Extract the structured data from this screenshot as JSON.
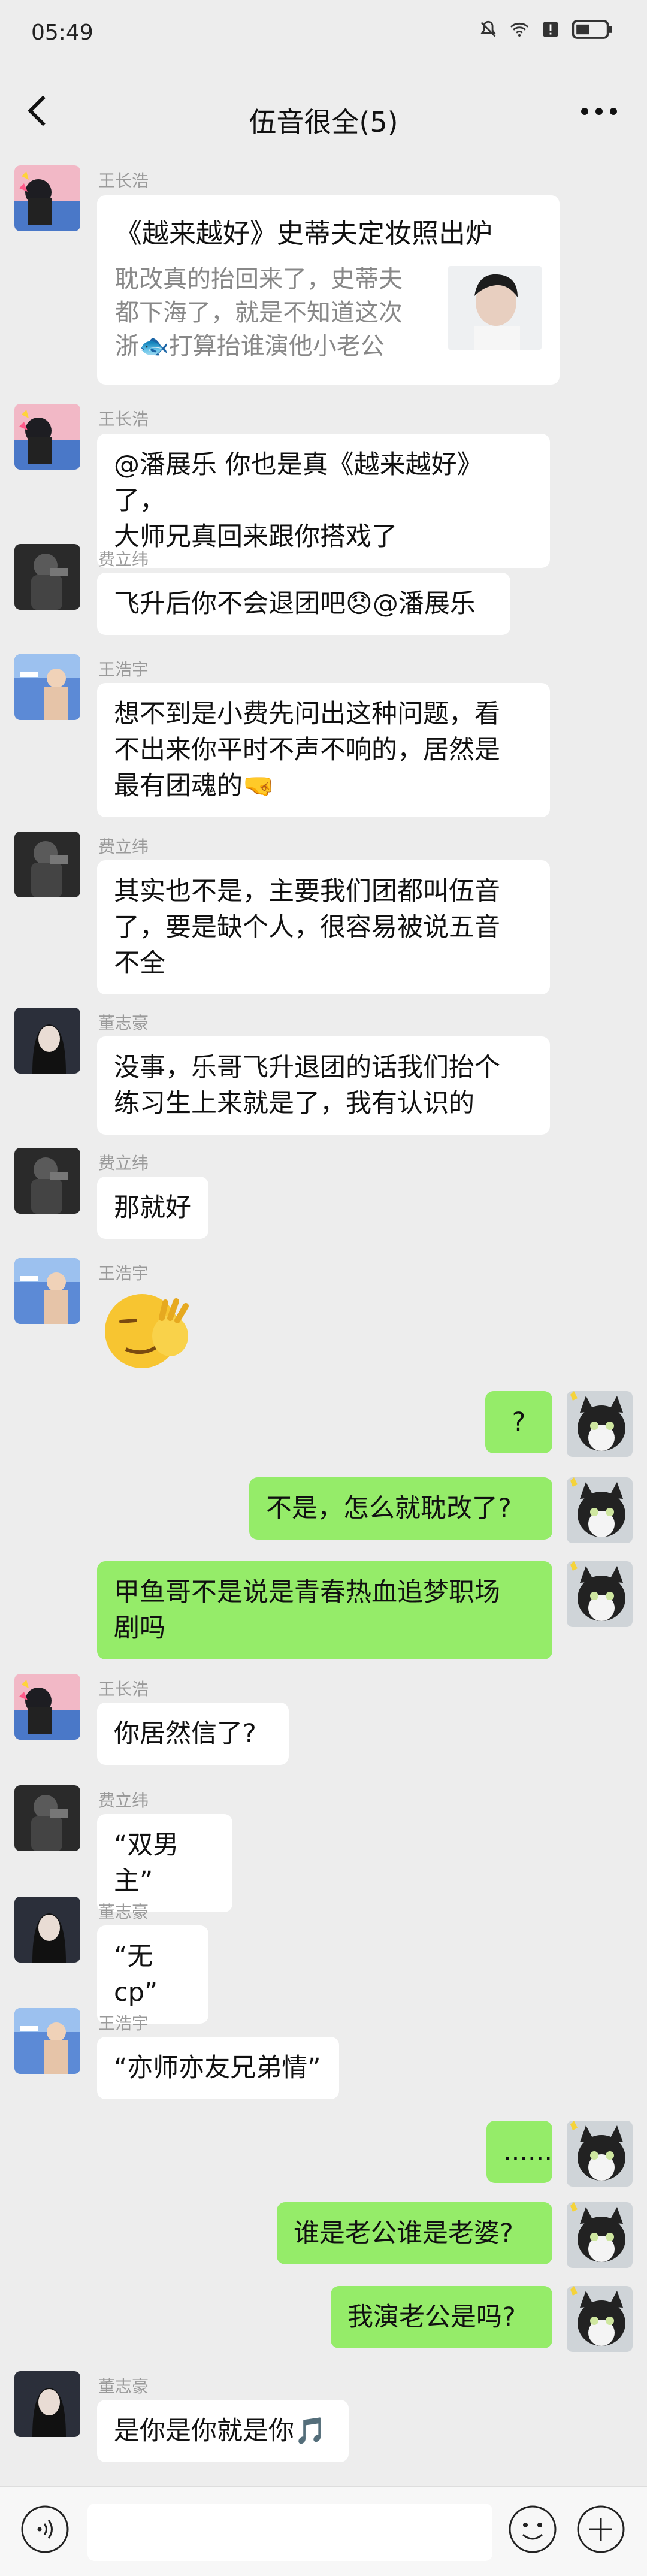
{
  "status_bar": {
    "time": "05:49",
    "icons": [
      "mute-bell-icon",
      "wifi-icon",
      "alert-icon",
      "battery-icon"
    ]
  },
  "header": {
    "title": "伍音很全(5)",
    "back_icon": "chevron-left-icon",
    "more_icon": "more-dots-icon"
  },
  "colors": {
    "background": "#ededed",
    "bubble_self": "#95ec69",
    "bubble_other": "#ffffff",
    "sender_name": "#9a9a9a"
  },
  "messages": [
    {
      "sender": "王长浩",
      "type": "link-card",
      "title": "《越来越好》史蒂夫定妆照出炉",
      "desc_line1": "耽改真的抬回来了，史蒂夫",
      "desc_line2": "都下海了，就是不知道这次",
      "desc_line3": "浙🐟打算抬谁演他小老公"
    },
    {
      "sender": "王长浩",
      "line1": "@潘展乐 你也是真《越来越好》了，",
      "line2": "大师兄真回来跟你搭戏了"
    },
    {
      "sender": "费立纬",
      "line1": "飞升后你不会退团吧😞@潘展乐"
    },
    {
      "sender": "王浩宇",
      "line1": "想不到是小费先问出这种问题，看",
      "line2": "不出来你平时不声不响的，居然是",
      "line3": "最有团魂的🤜"
    },
    {
      "sender": "费立纬",
      "line1": "其实也不是，主要我们团都叫伍音",
      "line2": "了，要是缺个人，很容易被说五音",
      "line3": "不全"
    },
    {
      "sender": "董志豪",
      "line1": "没事，乐哥飞升退团的话我们抬个",
      "line2": "练习生上来就是了，我有认识的"
    },
    {
      "sender": "费立纬",
      "line1": "那就好"
    },
    {
      "sender": "王浩宇",
      "type": "sticker",
      "sticker": "facepalm-emoji"
    },
    {
      "self": true,
      "line1": "?"
    },
    {
      "self": true,
      "line1": "不是，怎么就耽改了?"
    },
    {
      "self": true,
      "line1": "甲鱼哥不是说是青春热血追梦职场",
      "line2": "剧吗"
    },
    {
      "sender": "王长浩",
      "line1": "你居然信了?"
    },
    {
      "sender": "费立纬",
      "line1": "“双男主”"
    },
    {
      "sender": "董志豪",
      "line1": "“无cp”"
    },
    {
      "sender": "王浩宇",
      "line1": "“亦师亦友兄弟情”"
    },
    {
      "self": true,
      "line1": "......"
    },
    {
      "self": true,
      "line1": "谁是老公谁是老婆?"
    },
    {
      "self": true,
      "line1": "我演老公是吗?"
    },
    {
      "sender": "董志豪",
      "line1": "是你是你就是你🎵"
    }
  ],
  "input_bar": {
    "voice_icon": "voice-icon",
    "emoji_icon": "emoji-icon",
    "plus_icon": "plus-icon"
  }
}
